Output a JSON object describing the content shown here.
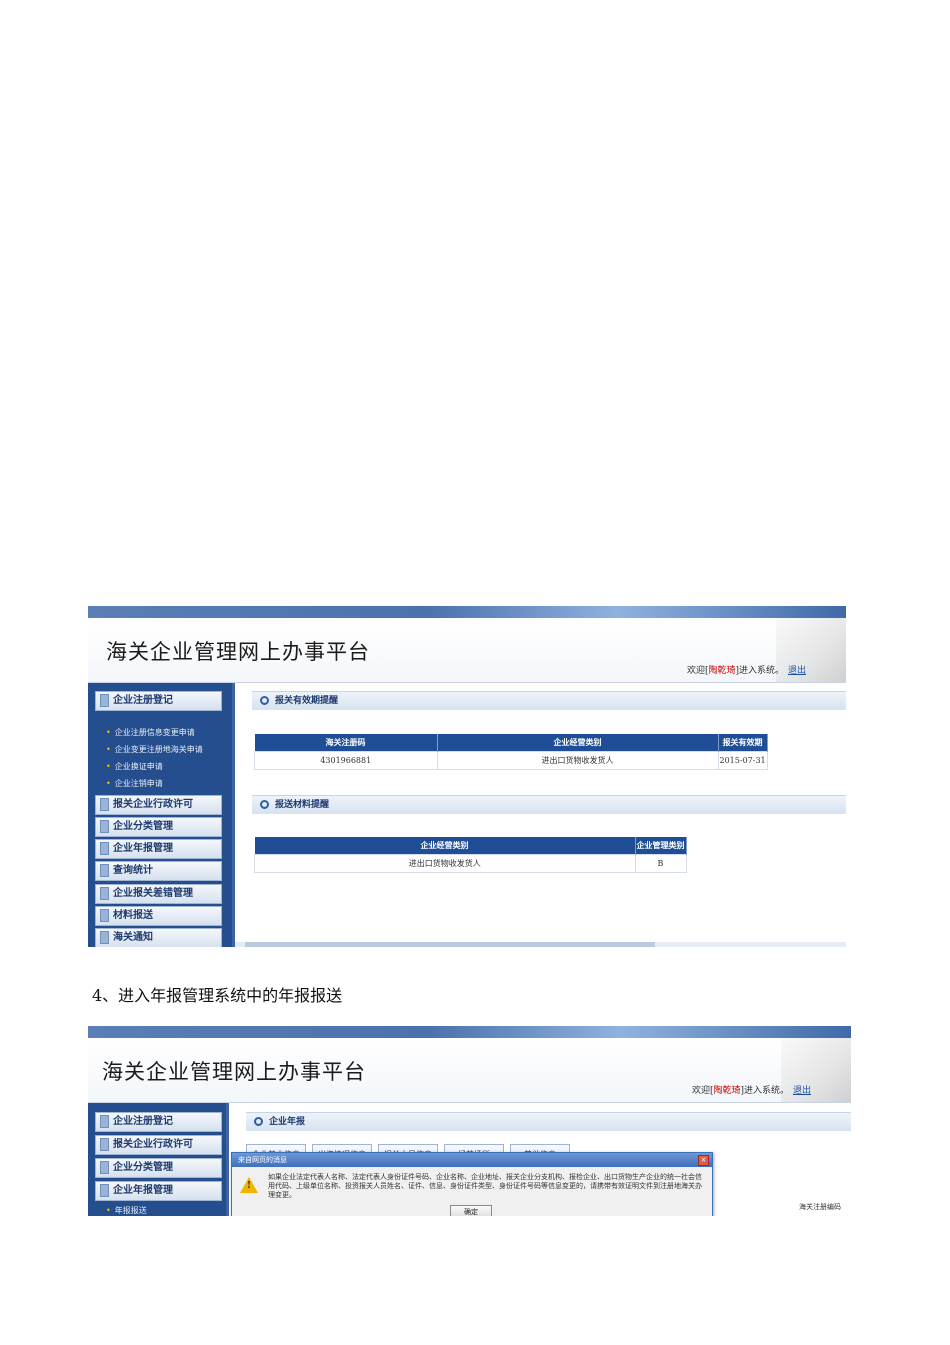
{
  "platform": {
    "title": "海关企业管理网上办事平台",
    "welcome_prefix": "欢迎[",
    "welcome_user": "陶乾琦",
    "welcome_suffix": "]进入系统。",
    "logout": "退出"
  },
  "screenshot1": {
    "menu": [
      {
        "label": "企业注册登记"
      },
      {
        "label": "报关企业行政许可"
      },
      {
        "label": "企业分类管理"
      },
      {
        "label": "企业年报管理"
      },
      {
        "label": "查询统计"
      },
      {
        "label": "企业报关差错管理"
      },
      {
        "label": "材料报送"
      },
      {
        "label": "海关通知"
      }
    ],
    "submenu": [
      {
        "label": "企业注册信息变更申请"
      },
      {
        "label": "企业变更注册地海关申请"
      },
      {
        "label": "企业换证申请"
      },
      {
        "label": "企业注销申请"
      }
    ],
    "section1": {
      "title": "报关有效期提醒",
      "columns": [
        "海关注册码",
        "企业经营类别",
        "报关有效期"
      ],
      "rows": [
        [
          "4301966881",
          "进出口货物收发货人",
          "2015-07-31"
        ]
      ]
    },
    "section2": {
      "title": "报送材料提醒",
      "columns": [
        "企业经营类别",
        "企业管理类别"
      ],
      "rows": [
        [
          "进出口货物收发货人",
          "B"
        ]
      ]
    }
  },
  "caption": "4、进入年报管理系统中的年报报送",
  "screenshot2": {
    "menu": [
      {
        "label": "企业注册登记"
      },
      {
        "label": "报关企业行政许可"
      },
      {
        "label": "企业分类管理"
      },
      {
        "label": "企业年报管理"
      }
    ],
    "submenu_label": "年报报送",
    "section_title": "企业年报",
    "tabs": [
      "企业基本信息",
      "出资情况信息",
      "报关人员信息",
      "经营场所",
      "其他信息"
    ],
    "dialog": {
      "title": "来自网页的消息",
      "close": "×",
      "message": "如果企业法定代表人名称、法定代表人身份证件号码、企业名称、企业地址、报关企业分支机构、报检企业、出口货物生产企业的统一社会信用代码、上级单位名称、投资报关人员姓名、证件、信息、身份证件类型、身份证件号码等信息变更的，请携带有效证明文件到注册地海关办理变更。",
      "button": "确定"
    },
    "right_label": "海关注册编码"
  }
}
